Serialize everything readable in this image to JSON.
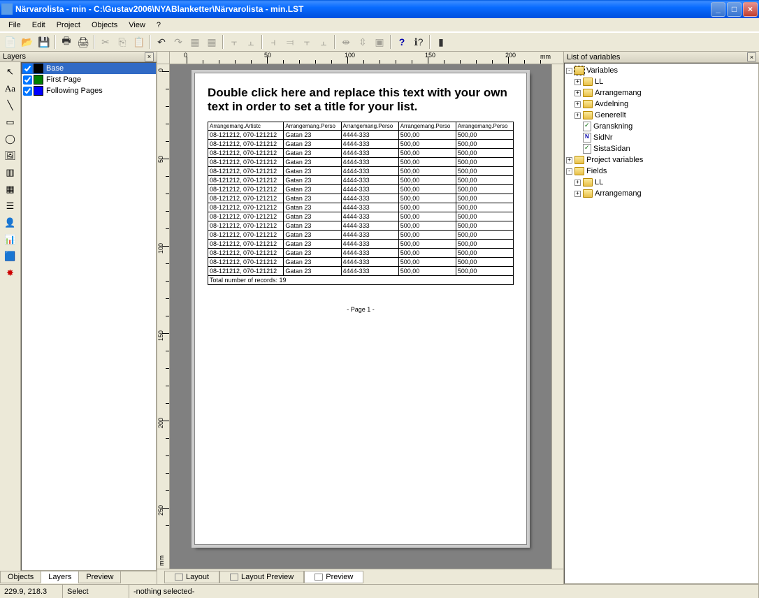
{
  "window": {
    "title": "Närvarolista - min - C:\\Gustav2006\\NYABlanketter\\Närvarolista - min.LST"
  },
  "menu": [
    "File",
    "Edit",
    "Project",
    "Objects",
    "View",
    "?"
  ],
  "panels": {
    "layers_title": "Layers",
    "variables_title": "List of variables"
  },
  "layers": [
    {
      "checked": true,
      "color": "#000000",
      "name": "Base",
      "selected": true
    },
    {
      "checked": true,
      "color": "#008000",
      "name": "First Page",
      "selected": false
    },
    {
      "checked": true,
      "color": "#0000FF",
      "name": "Following Pages",
      "selected": false
    }
  ],
  "ruler": {
    "h_labels": [
      "0",
      "50",
      "100",
      "150",
      "200"
    ],
    "v_labels": [
      "0",
      "50",
      "100",
      "150",
      "200",
      "250"
    ],
    "unit_h": "mm",
    "unit_v": "mm"
  },
  "document": {
    "title_text": "Double click here and replace this text with your own text in order to set a title for your list.",
    "headers": [
      "Arrangemang.Artistc",
      "Arrangemang.Perso",
      "Arrangemang.Perso",
      "Arrangemang.Perso",
      "Arrangemang.Perso"
    ],
    "row": [
      "08-121212, 070-121212",
      "Gatan 23",
      "4444-333",
      "500,00",
      "500,00"
    ],
    "row_count": 16,
    "footer_text": "Total number of records: 19",
    "page_label": "- Page 1 -"
  },
  "tree": {
    "root": "Variables",
    "children": [
      {
        "type": "folder",
        "name": "LL",
        "expandable": true
      },
      {
        "type": "folder",
        "name": "Arrangemang",
        "expandable": true
      },
      {
        "type": "folder",
        "name": "Avdelning",
        "expandable": true
      },
      {
        "type": "folder",
        "name": "Generellt",
        "expandable": true
      },
      {
        "type": "check",
        "name": "Granskning"
      },
      {
        "type": "num",
        "name": "SidNr"
      },
      {
        "type": "check",
        "name": "SistaSidan"
      }
    ],
    "proj_vars": "Project variables",
    "fields": "Fields",
    "fields_children": [
      {
        "type": "folder",
        "name": "LL",
        "expandable": true
      },
      {
        "type": "folder",
        "name": "Arrangemang",
        "expandable": true
      }
    ]
  },
  "bottom_tabs": [
    "Objects",
    "Layers",
    "Preview"
  ],
  "view_tabs": [
    "Layout",
    "Layout Preview",
    "Preview"
  ],
  "status": {
    "coords": "229.9, 218.3",
    "mode": "Select",
    "selection": "-nothing selected-"
  }
}
